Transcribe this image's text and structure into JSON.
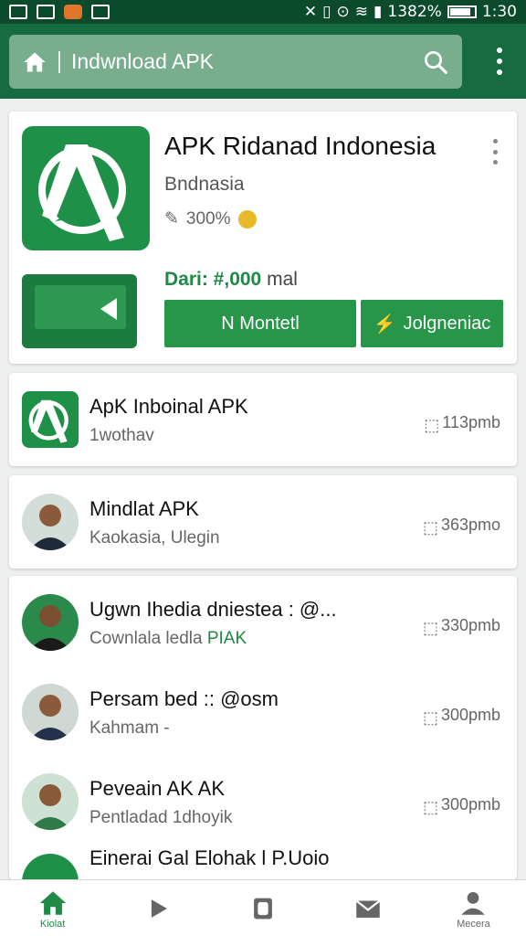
{
  "status_bar": {
    "battery": "1382%",
    "time": "1:30"
  },
  "search": {
    "value": "Indwnload APK"
  },
  "featured": {
    "title": "APK Ridanad Indonesia",
    "subtitle": "Bndnasia",
    "rating": "300%",
    "price_label": "Dari: #,000",
    "price_unit": "mal",
    "primary_button": "N Montetl",
    "secondary_button": "Jolgneniac"
  },
  "apps": [
    {
      "title": "ApK Inboinal APK",
      "subtitle": "1wothav",
      "size": "113pmb"
    },
    {
      "title": "Mindlat APK",
      "subtitle": "Kaokasia, Ulegin",
      "size": "363pmo"
    },
    {
      "title": "Ugwn Ihedia dniestea : @...",
      "subtitle": "Cownlala ledla",
      "subtitle_accent": "PIAK",
      "size": "330pmb"
    },
    {
      "title": "Persam bed :: @osm",
      "subtitle": "Kahmam -",
      "size": "300pmb"
    },
    {
      "title": "Peveain AK AK",
      "subtitle": "Pentladad 1dhoyik",
      "size": "300pmb"
    },
    {
      "title": "Einerai Gal Elohak l P.Uoio",
      "subtitle": "",
      "size": ""
    }
  ],
  "bottom_nav": [
    {
      "label": "Kiolat",
      "icon": "home-icon"
    },
    {
      "label": "",
      "icon": "play-icon"
    },
    {
      "label": "",
      "icon": "apps-icon"
    },
    {
      "label": "",
      "icon": "mail-icon"
    },
    {
      "label": "Mecera",
      "icon": "person-icon"
    }
  ]
}
